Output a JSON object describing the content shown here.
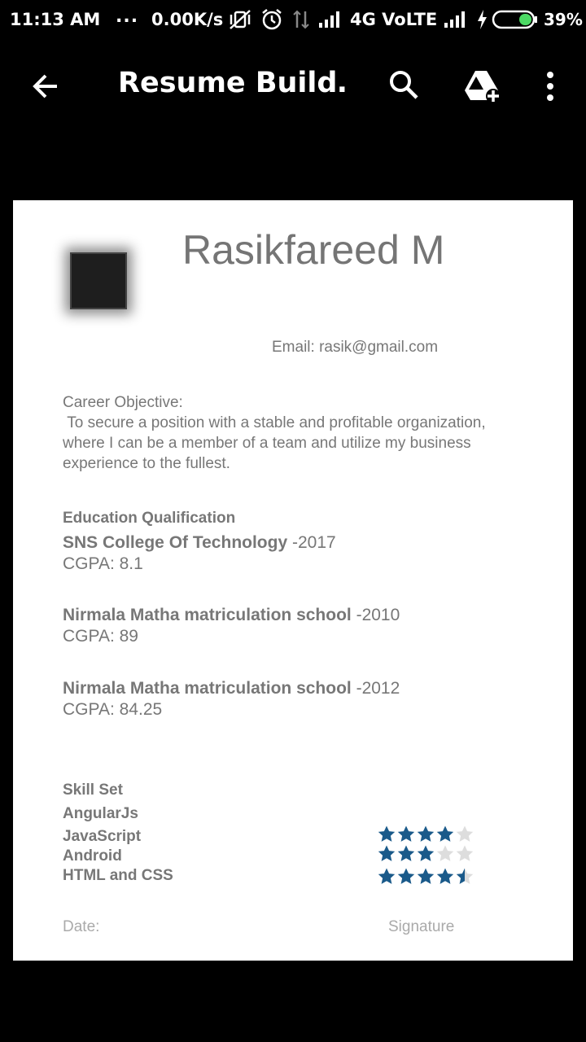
{
  "status_bar": {
    "time": "11:13 AM",
    "dots": "...",
    "speed": "0.00K/s",
    "network": "4G VoLTE",
    "battery": "39%",
    "battery_color": "#4cd964"
  },
  "app_bar": {
    "title": "Resume Build…",
    "icons": [
      "back-arrow-icon",
      "search-icon",
      "drive-add-icon",
      "more-vert-icon"
    ]
  },
  "resume": {
    "name": "Rasikfareed M",
    "email": "Email: rasik@gmail.com",
    "career_label": "Career Objective:",
    "career_text": " To secure a position with a stable and profitable organization, where I can be a member of a team and utilize my business experience to the fullest.",
    "education_title": "Education Qualification",
    "education": [
      {
        "school": "SNS College Of Technology",
        "year": " -2017",
        "cgpa": "CGPA: 8.1"
      },
      {
        "school": "Nirmala Matha matriculation school",
        "year": " -2010",
        "cgpa": "CGPA: 89"
      },
      {
        "school": "Nirmala Matha matriculation school",
        "year": " -2012",
        "cgpa": "CGPA: 84.25"
      }
    ],
    "skills_title": "Skill Set",
    "skills": [
      {
        "name": "AngularJs",
        "rating": null
      },
      {
        "name": "JavaScript",
        "rating": 4
      },
      {
        "name": "Android",
        "rating": 3
      },
      {
        "name": "HTML and CSS",
        "rating": 4.5
      }
    ],
    "star_color": "#1a5a8a",
    "star_empty_color": "#dddddd",
    "date_label": "Date:",
    "signature_label": "Signature"
  }
}
